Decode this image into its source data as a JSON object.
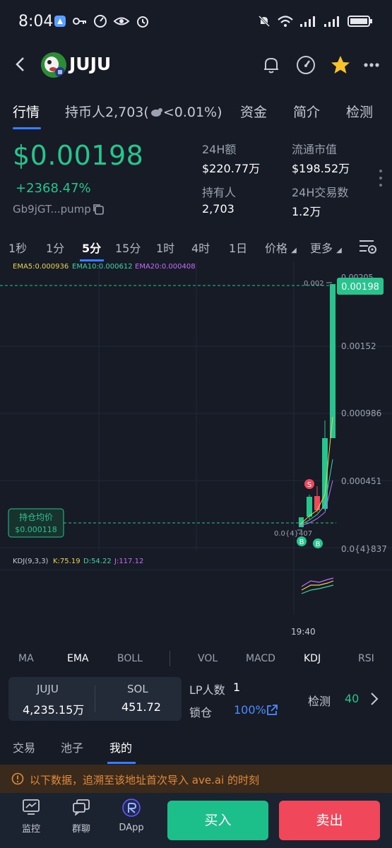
{
  "status_bar": {
    "time": "8:04"
  },
  "header": {
    "token_name": "JUJU"
  },
  "tabs": [
    {
      "label": "行情"
    },
    {
      "label": "持币人2,703("
    },
    {
      "label": "<0.01%)"
    },
    {
      "label": "资金"
    },
    {
      "label": "简介"
    },
    {
      "label": "检测"
    }
  ],
  "price": {
    "value": "$0.00198",
    "change": "+2368.47%",
    "address": "Gb9jGT...pump"
  },
  "stats": {
    "vol24h_label": "24H额",
    "vol24h_value": "$220.77万",
    "mcap_label": "流通市值",
    "mcap_value": "$198.52万",
    "holders_label": "持有人",
    "holders_value": "2,703",
    "tx24h_label": "24H交易数",
    "tx24h_value": "1.2万"
  },
  "intervals": [
    "1秒",
    "1分",
    "5分",
    "15分",
    "1时",
    "4时",
    "1日",
    "价格",
    "更多"
  ],
  "chart_data": {
    "type": "line",
    "ema_labels": [
      "EMA5:0.000936",
      "EMA10:0.000612",
      "EMA20:0.000408"
    ],
    "y_ticks": [
      "0.00205",
      "0.00152",
      "0.000986",
      "0.000451",
      "0.0{4}837"
    ],
    "current_price_tag": "0.00198",
    "high_label": "0.002",
    "low_label": "0.0{4}407",
    "avg_cost_label": "持仓均价",
    "avg_cost_value": "$0.000118",
    "kdj_label": "KDJ(9,3,3)",
    "kdj_k": "K:75.19",
    "kdj_d": "D:54.22",
    "kdj_j": "J:117.12",
    "x_tick": "19:40",
    "marker_s": "S",
    "marker_b": "B",
    "colors": {
      "up": "#27c48d",
      "down": "#f0475a",
      "ema5": "#e8d44d",
      "ema10": "#3fd1a6",
      "ema20": "#c76cff"
    }
  },
  "indicators": [
    "MA",
    "EMA",
    "BOLL",
    "VOL",
    "MACD",
    "KDJ",
    "RSI"
  ],
  "pair": {
    "token_label": "JUJU",
    "token_value": "4,235.15万",
    "sol_label": "SOL",
    "sol_value": "451.72"
  },
  "lp": {
    "label": "LP人数",
    "value": "1",
    "lock_label": "锁仓",
    "lock_value": "100%"
  },
  "check": {
    "label": "检测",
    "value": "40"
  },
  "subtabs": [
    "交易",
    "池子",
    "我的"
  ],
  "notice": "以下数据，追溯至该地址首次导入 ave.ai 的时刻",
  "bottom_nav": [
    {
      "label": "监控"
    },
    {
      "label": "群聊"
    },
    {
      "label": "DApp"
    }
  ],
  "buttons": {
    "buy": "买入",
    "sell": "卖出"
  }
}
